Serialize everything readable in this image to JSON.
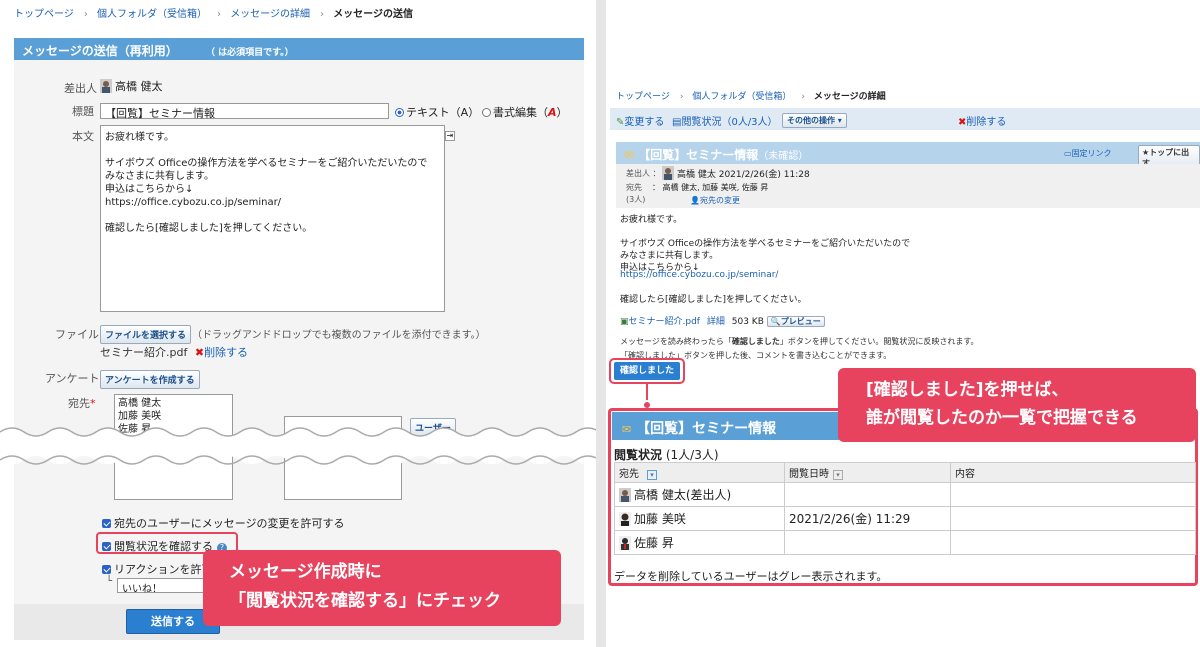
{
  "left": {
    "breadcrumb": [
      "トップページ",
      "個人フォルダ（受信箱）",
      "メッセージの詳細",
      "メッセージの送信"
    ],
    "title": "メッセージの送信（再利用）",
    "required_note": "（ は必須項目です。）",
    "sender_label": "差出人",
    "sender_name": "高橋 健太",
    "subject_label": "標題",
    "subject_value": "【回覧】セミナー情報",
    "radio_text": "テキスト（A）",
    "radio_rich": "書式編集（",
    "radio_rich_a": "A",
    "radio_rich_end": "）",
    "body_label": "本文",
    "body_text": "お疲れ様です。\n\nサイボウズ Officeの操作方法を学べるセミナーをご紹介いただいたので\nみなさまに共有します。\n申込はこちらから↓\nhttps://office.cybozu.co.jp/seminar/\n\n確認したら[確認しました]を押してください。",
    "file_label": "ファイル",
    "file_button": "ファイルを選択する",
    "file_hint": "（ドラッグアンドドロップでも複数のファイルを添付できます。）",
    "file_name": "セミナー紹介.pdf",
    "file_delete": "削除する",
    "survey_label": "アンケート",
    "survey_button": "アンケートを作成する",
    "recipients_label": "宛先",
    "recipients": [
      "高橋 健太",
      "加藤 美咲",
      "佐藤 昇"
    ],
    "user_button": "ユーザー",
    "opt_allow_change": "宛先のユーザーにメッセージの変更を許可する",
    "opt_read_status": "閲覧状況を確認する",
    "opt_reaction": "リアクションを許可",
    "reaction_value": "いいね！",
    "send_button": "送信する",
    "callout_line1": "メッセージ作成時に",
    "callout_line2": "「閲覧状況を確認する」にチェック"
  },
  "right": {
    "breadcrumb": [
      "トップページ",
      "個人フォルダ（受信箱）",
      "メッセージの詳細"
    ],
    "toolbar_edit": "変更する",
    "toolbar_status": "閲覧状況（0人/3人）",
    "toolbar_other": "その他の操作",
    "toolbar_delete": "削除する",
    "msg_title": "【回覧】セミナー情報",
    "msg_unconfirmed": "（未確認）",
    "fixed_link": "固定リンク",
    "to_top": "トップに出す",
    "sender_label": "差出人 ：",
    "sender_value": "高橋 健太 2021/2/26(金) 11:28",
    "recipients_label": "宛先",
    "recipients_count": "(3人)",
    "recipients_value": "： 高橋 健太,  加藤 美咲, 佐藤 昇",
    "change_recipients": "宛先の変更",
    "body_text": "お疲れ様です。\n\nサイボウズ Officeの操作方法を学べるセミナーをご紹介いただいたので\nみなさまに共有します。\n申込はこちらから↓",
    "body_url": "https://office.cybozu.co.jp/seminar/",
    "body_after": "確認したら[確認しました]を押してください。",
    "attach_name": "セミナー紹介.pdf",
    "attach_detail": "詳細",
    "attach_size": "503 KB",
    "attach_preview": "プレビュー",
    "note_pre": "メッセージを読み終わったら「",
    "note_bold": "確認しました",
    "note_post": "」ボタンを押してください。閲覧状況に反映されます。",
    "note2": "「確認しました」ボタンを押した後、コメントを書き込むことができます。",
    "confirm_button": "確認しました",
    "callout_line1": "[確認しました]を押せば、",
    "callout_line2": "誰が閲覧したのか一覧で把握できる",
    "detail_title": "【回覧】セミナー情報",
    "status_heading": "閲覧状況",
    "status_count": "(1人/3人)",
    "col_to": "宛先",
    "col_time": "閲覧日時",
    "col_content": "内容",
    "rows": [
      {
        "name": "高橋 健太(差出人)",
        "time": "",
        "content": ""
      },
      {
        "name": "加藤 美咲",
        "time": "2021/2/26(金) 11:29",
        "content": ""
      },
      {
        "name": "佐藤 昇",
        "time": "",
        "content": ""
      }
    ],
    "footer_note": "データを削除しているユーザーはグレー表示されます。"
  },
  "colors": {
    "accent_blue": "#5aa0d6",
    "callout_pink": "#e8435e",
    "button_blue": "#2b7fd0"
  }
}
